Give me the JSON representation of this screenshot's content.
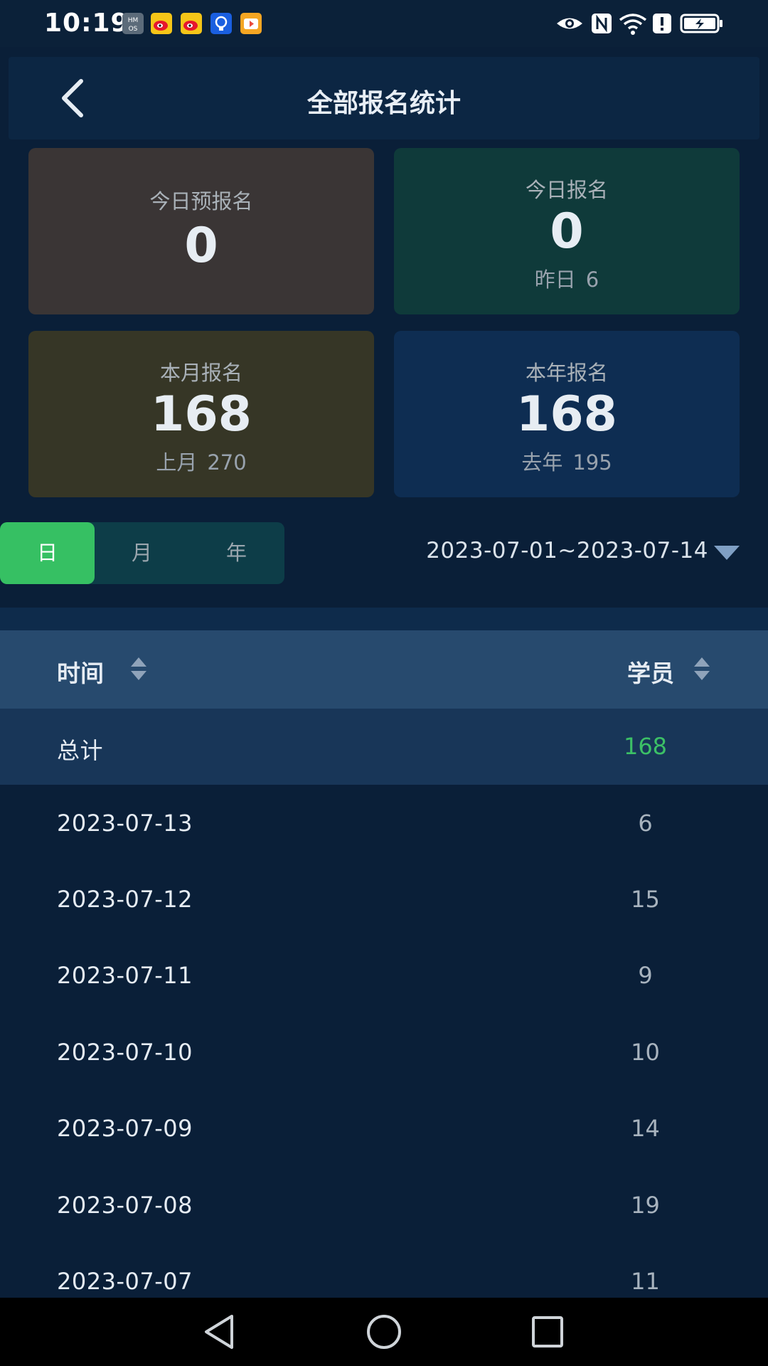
{
  "status_bar": {
    "time": "10:19",
    "notification_icons": [
      "hmos-icon",
      "weibo-icon",
      "weibo-icon",
      "bulb-app-icon",
      "video-app-icon"
    ],
    "right_icons": [
      "eye-icon",
      "nfc-icon",
      "wifi-icon",
      "alert-icon",
      "battery-charging-icon"
    ]
  },
  "header": {
    "title": "全部报名统计",
    "back_icon": "chevron-left-icon"
  },
  "cards": {
    "today_pre": {
      "label": "今日预报名",
      "value": "0"
    },
    "today": {
      "label": "今日报名",
      "value": "0",
      "sub_label": "昨日",
      "sub_value": "6"
    },
    "month": {
      "label": "本月报名",
      "value": "168",
      "sub_label": "上月",
      "sub_value": "270"
    },
    "year": {
      "label": "本年报名",
      "value": "168",
      "sub_label": "去年",
      "sub_value": "195"
    }
  },
  "period_tabs": {
    "items": [
      {
        "label": "日",
        "active": true
      },
      {
        "label": "月",
        "active": false
      },
      {
        "label": "年",
        "active": false
      }
    ]
  },
  "date_range": {
    "value": "2023-07-01~2023-07-14",
    "icon": "triangle-down-icon"
  },
  "table": {
    "columns": [
      "时间",
      "学员"
    ],
    "sort_icon": "sort-updown-icon",
    "total": {
      "label": "总计",
      "value": "168"
    },
    "rows": [
      {
        "date": "2023-07-13",
        "count": "6"
      },
      {
        "date": "2023-07-12",
        "count": "15"
      },
      {
        "date": "2023-07-11",
        "count": "9"
      },
      {
        "date": "2023-07-10",
        "count": "10"
      },
      {
        "date": "2023-07-09",
        "count": "14"
      },
      {
        "date": "2023-07-08",
        "count": "19"
      },
      {
        "date": "2023-07-07",
        "count": "11"
      }
    ]
  },
  "colors": {
    "background": "#0a1f38",
    "accent_green": "#36c063",
    "card_pre": "#3a3535",
    "card_today": "#0f3a3a",
    "card_month": "#363626",
    "card_year": "#0e2d52",
    "table_header": "#274a6e",
    "total_row": "#183658"
  },
  "nav_bar": {
    "icons": [
      "nav-back-icon",
      "nav-home-icon",
      "nav-recents-icon"
    ]
  }
}
